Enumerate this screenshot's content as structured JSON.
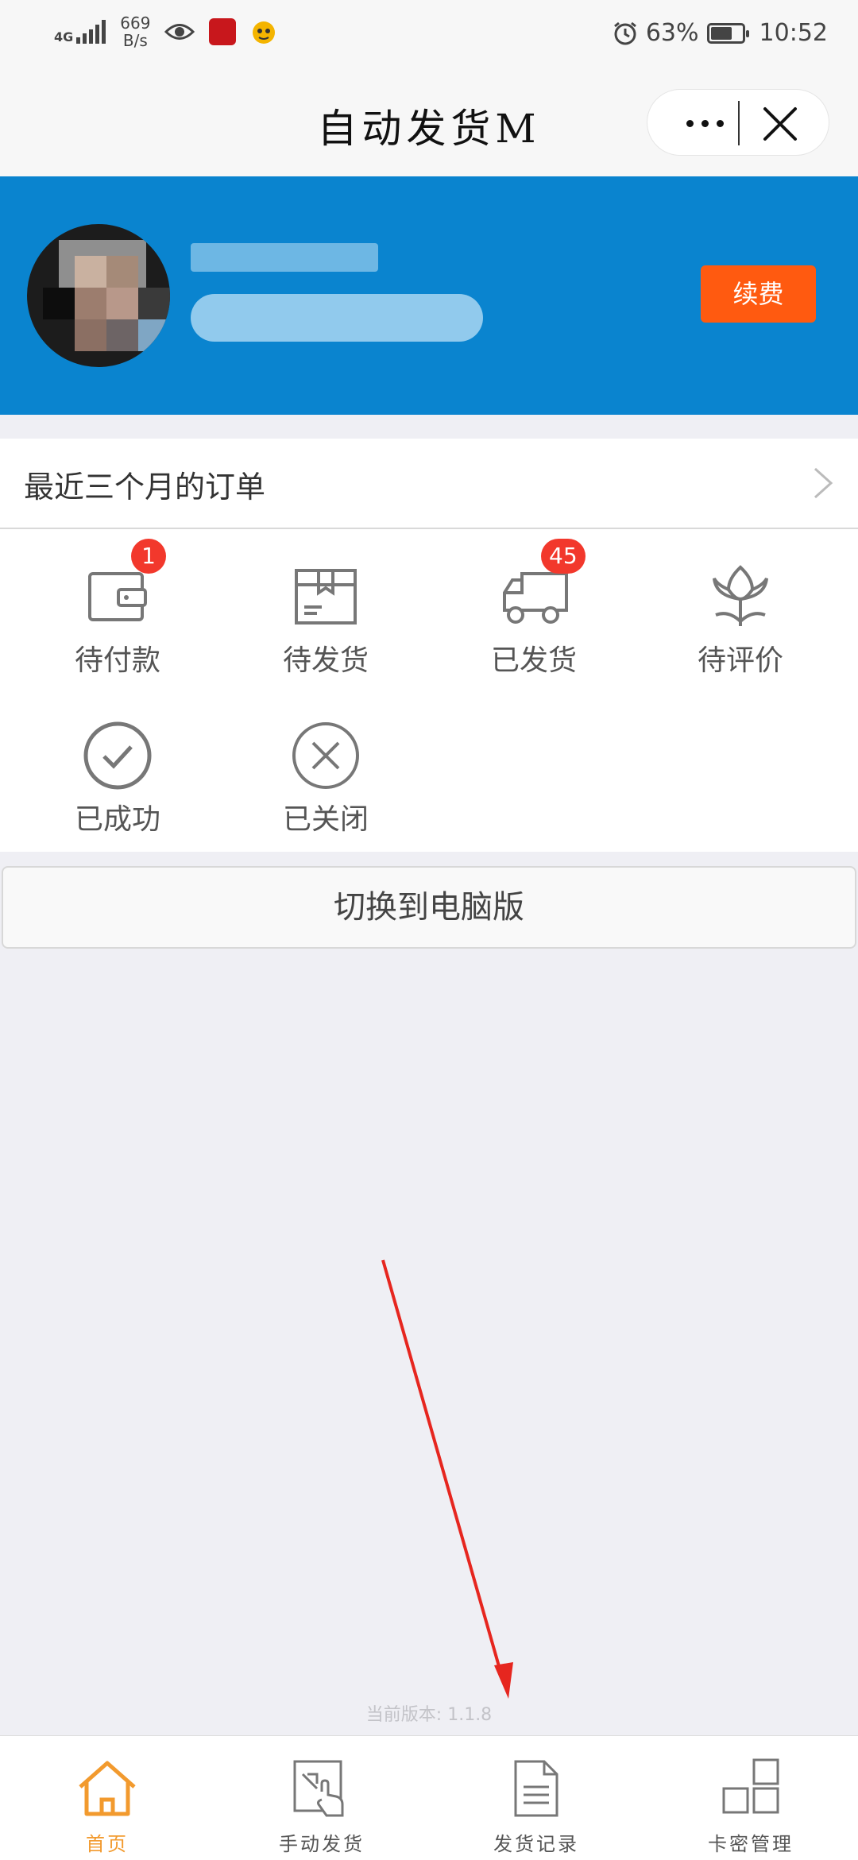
{
  "status_bar": {
    "network": "4G",
    "speed_value": "669",
    "speed_unit": "B/s",
    "battery_percent": "63%",
    "time": "10:52",
    "icons": [
      "signal-icon",
      "eye-icon",
      "app-red-icon",
      "app-yellow-icon",
      "alarm-icon",
      "battery-icon"
    ]
  },
  "navbar": {
    "title": "自动发货M",
    "more_icon": "more-dots-icon",
    "close_icon": "close-icon"
  },
  "profile": {
    "renew_label": "续费",
    "colors": {
      "banner": "#0a84cf",
      "renew": "#ff5a10"
    }
  },
  "orders": {
    "recent_label": "最近三个月的订单",
    "items": [
      {
        "label": "待付款",
        "icon": "wallet-icon",
        "badge": "1"
      },
      {
        "label": "待发货",
        "icon": "package-icon",
        "badge": ""
      },
      {
        "label": "已发货",
        "icon": "truck-icon",
        "badge": "45"
      },
      {
        "label": "待评价",
        "icon": "flower-icon",
        "badge": ""
      },
      {
        "label": "已成功",
        "icon": "check-circle-icon",
        "badge": ""
      },
      {
        "label": "已关闭",
        "icon": "x-circle-icon",
        "badge": ""
      }
    ]
  },
  "switch_button": "切换到电脑版",
  "version_text": "当前版本: 1.1.8",
  "tabbar": {
    "tabs": [
      {
        "label": "首页",
        "icon": "home-icon",
        "active": true
      },
      {
        "label": "手动发货",
        "icon": "manual-ship-icon",
        "active": false
      },
      {
        "label": "发货记录",
        "icon": "document-icon",
        "active": false
      },
      {
        "label": "卡密管理",
        "icon": "grid-icon",
        "active": false
      }
    ],
    "active_color": "#f29a2e"
  }
}
